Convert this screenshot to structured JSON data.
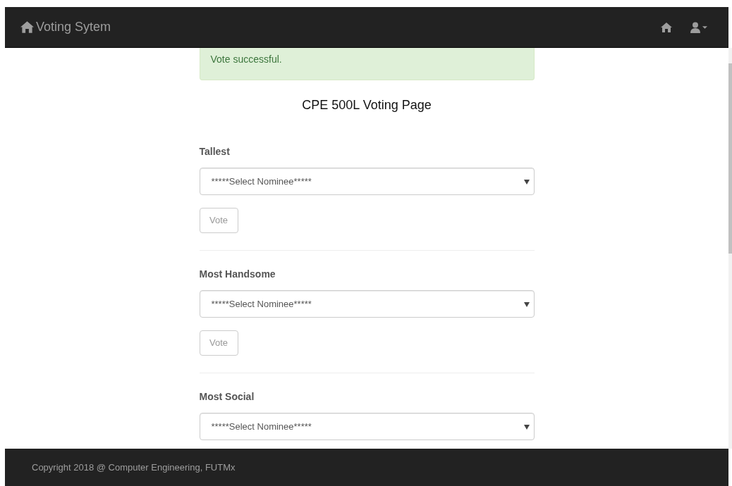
{
  "navbar": {
    "brand": "Voting Sytem"
  },
  "alert": {
    "message": "Vote successful."
  },
  "title": "CPE 500L Voting Page",
  "categories": [
    {
      "label": "Tallest",
      "select": "*****Select Nominee*****",
      "button": "Vote"
    },
    {
      "label": "Most Handsome",
      "select": "*****Select Nominee*****",
      "button": "Vote"
    },
    {
      "label": "Most Social",
      "select": "*****Select Nominee*****"
    }
  ],
  "footer": "Copyright 2018 @ Computer Engineering, FUTMx"
}
